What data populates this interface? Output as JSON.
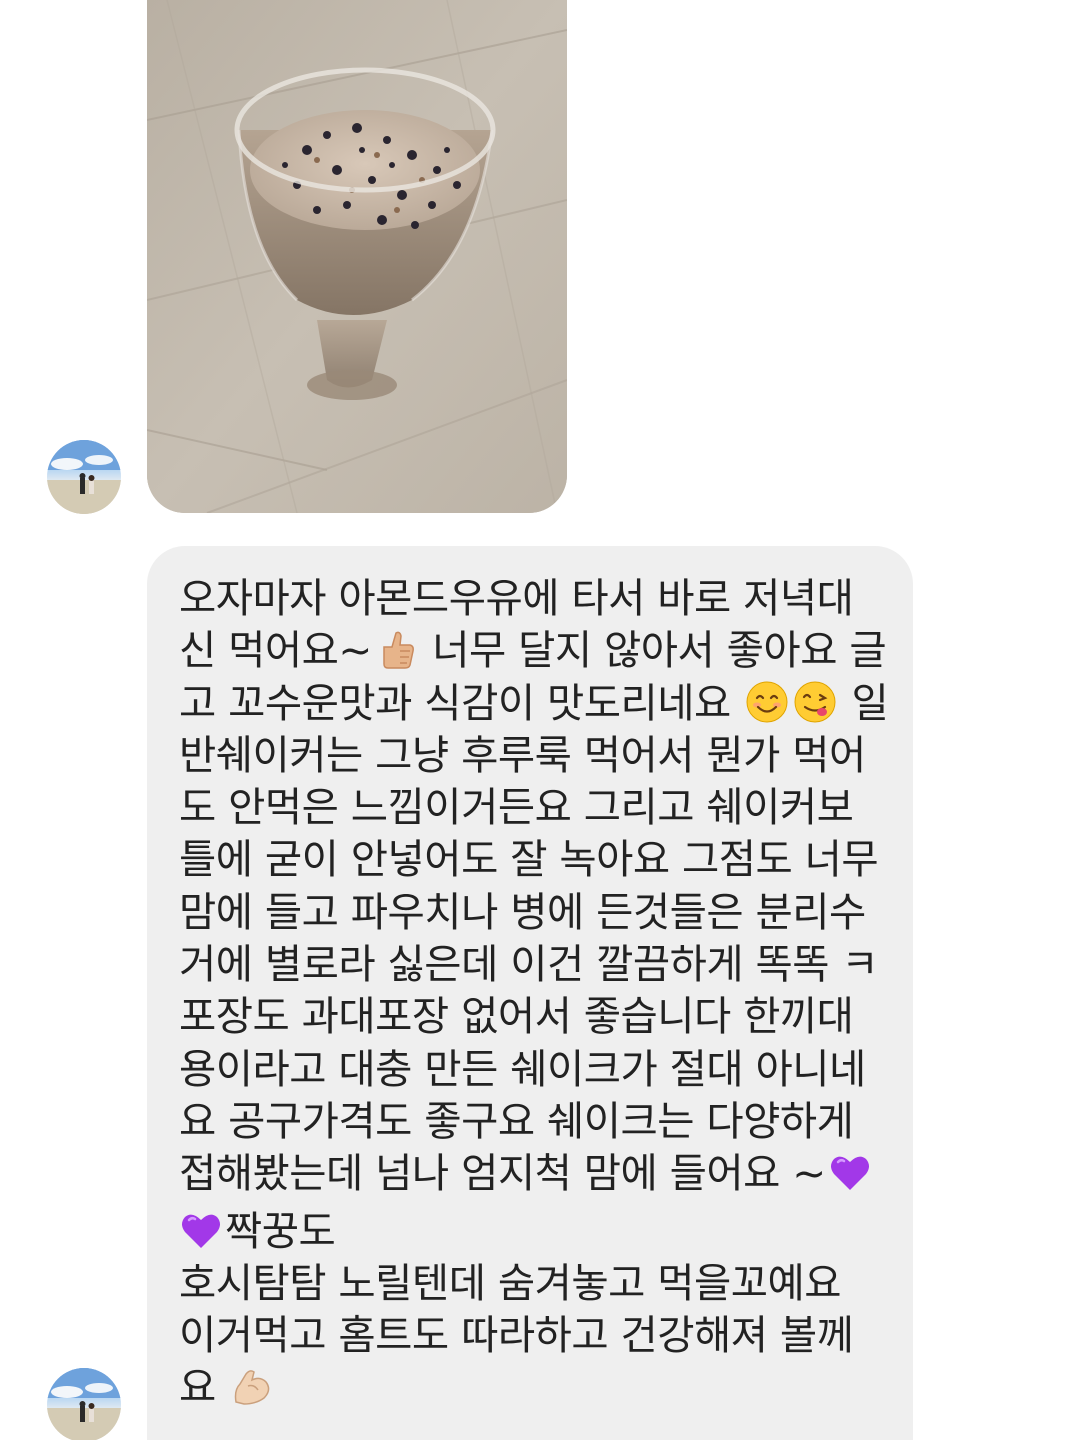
{
  "chat": {
    "photo": {
      "description_icon": "almond-milk-shake-photo"
    },
    "message": {
      "lines": [
        "오자마자 아몬드우유에 타서 바로 저녁대",
        "신 먹어요~",
        "너무 달지 않아서 좋아요 글",
        "고 꼬수운맛과 식감이 맛도리네요",
        "일",
        "반쉐이커는 그냥 후루룩 먹어서 뭔가 먹어",
        "도 안먹은 느낌이거든요  그리고 쉐이커보",
        "틀에 굳이 안넣어도 잘 녹아요  그점도 너무",
        "맘에 들고 파우치나 병에 든것들은 분리수",
        "거에 별로라 싫은데 이건 깔끔하게 똑똑 ㅋ",
        "포장도 과대포장 없어서 좋습니다 한끼대",
        "용이라고 대충 만든 쉐이크가 절대 아니네",
        "요 공구가격도 좋구요 쉐이크는 다양하게",
        "접해봤는데 넘나 엄지척 맘에 들어요 ~",
        "짝꿍도",
        "호시탐탐 노릴텐데 숨겨놓고 먹을꼬예요",
        "이거먹고 홈트도 따라하고 건강해져 볼께",
        "요"
      ]
    },
    "icons": {
      "thumbs_up": "thumbs-up-icon",
      "smile": "smiling-face-icon",
      "yum": "face-savoring-food-icon",
      "heart": "purple-heart-icon",
      "muscle": "flexed-biceps-icon"
    },
    "colors": {
      "bubble": "#efefef",
      "text": "#222222",
      "heart": "#a238e8"
    }
  }
}
